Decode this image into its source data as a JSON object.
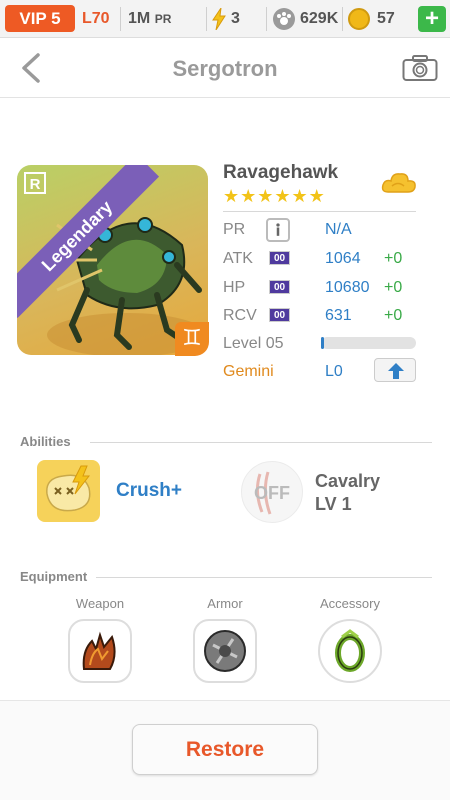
{
  "status_bar": {
    "vip": "VIP 5",
    "level": "L70",
    "power_value": "1M",
    "power_unit": "PR",
    "energy": "3",
    "paws": "629K",
    "coins": "57",
    "add_label": "+"
  },
  "header": {
    "title": "Sergotron",
    "back_icon": "chevron-left-icon",
    "camera_icon": "camera-icon"
  },
  "creature": {
    "name": "Ravagehawk",
    "rarity": "Legendary",
    "stars": "★★★★★★",
    "star_count": 6,
    "element_icon": "cloud-icon",
    "sign_icon": "gemini-icon",
    "sign_glyph": "♊"
  },
  "stats": {
    "pr_label": "PR",
    "pr_value": "N/A",
    "atk_label": "ATK",
    "atk_value": "1064",
    "atk_bonus": "+0",
    "hp_label": "HP",
    "hp_value": "10680",
    "hp_bonus": "+0",
    "rcv_label": "RCV",
    "rcv_value": "631",
    "rcv_bonus": "+0",
    "badge_text": "00",
    "level_label": "Level 05",
    "level_progress": 0.03,
    "sign_label": "Gemini",
    "sign_level": "L0"
  },
  "abilities": {
    "title": "Abilities",
    "ability1_label": "Crush+",
    "ability2_state": "OFF",
    "ability2_label_line1": "Cavalry",
    "ability2_label_line2": "LV 1"
  },
  "equipment": {
    "title": "Equipment",
    "weapon_label": "Weapon",
    "armor_label": "Armor",
    "accessory_label": "Accessory"
  },
  "footer": {
    "restore_label": "Restore"
  },
  "colors": {
    "accent_orange": "#e8582a",
    "stat_blue": "#2f7fc6",
    "bonus_green": "#3aaa48",
    "legendary_purple": "#7b5fb8",
    "star_yellow": "#f2c318"
  }
}
